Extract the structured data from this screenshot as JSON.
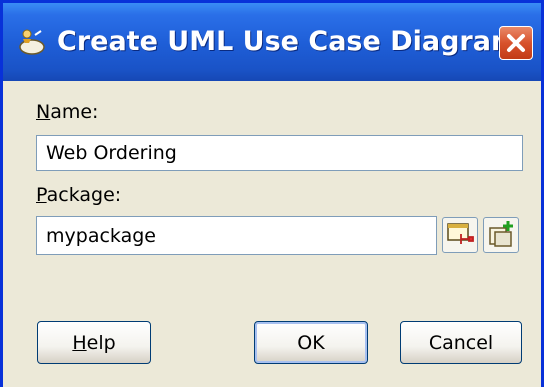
{
  "dialog": {
    "title": "Create UML Use Case Diagram",
    "title_icon": "uml-diagram-icon",
    "close_icon": "close-icon"
  },
  "form": {
    "name_label_mnemonic": "N",
    "name_label_rest": "ame:",
    "name_value": "Web Ordering",
    "package_label_mnemonic": "P",
    "package_label_rest": "ackage:",
    "package_value": "mypackage",
    "browse_icon": "browse-package-icon",
    "new_package_icon": "new-package-icon"
  },
  "buttons": {
    "help_mnemonic": "H",
    "help_rest": "elp",
    "ok": "OK",
    "cancel": "Cancel"
  },
  "colors": {
    "title_bar": "#1f5fd8",
    "close_button": "#d8522c",
    "dialog_background": "#ece9d8",
    "field_border": "#7f9db9"
  }
}
